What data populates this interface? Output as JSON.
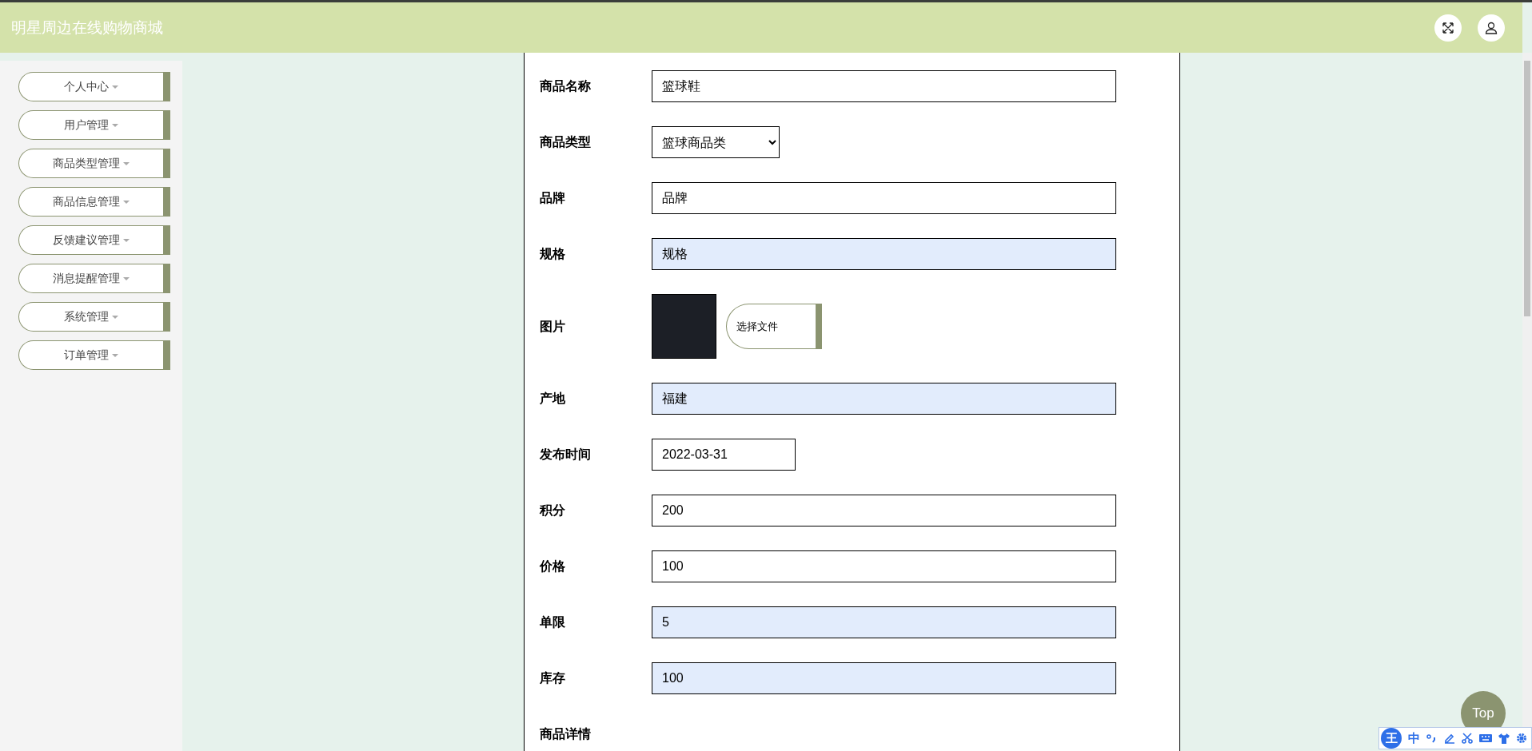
{
  "header": {
    "title": "明星周边在线购物商城"
  },
  "sidebar": {
    "items": [
      {
        "label": "个人中心"
      },
      {
        "label": "用户管理"
      },
      {
        "label": "商品类型管理"
      },
      {
        "label": "商品信息管理"
      },
      {
        "label": "反馈建议管理"
      },
      {
        "label": "消息提醒管理"
      },
      {
        "label": "系统管理"
      },
      {
        "label": "订单管理"
      }
    ]
  },
  "form": {
    "fields": [
      {
        "kind": "text",
        "label": "商品名称",
        "value": "篮球鞋",
        "autofilled": false
      },
      {
        "kind": "select",
        "label": "商品类型",
        "value": "篮球商品类"
      },
      {
        "kind": "text",
        "label": "品牌",
        "value": "品牌",
        "autofilled": false
      },
      {
        "kind": "text",
        "label": "规格",
        "value": "规格",
        "autofilled": true
      },
      {
        "kind": "image",
        "label": "图片",
        "button": "选择文件"
      },
      {
        "kind": "text",
        "label": "产地",
        "value": "福建",
        "autofilled": true
      },
      {
        "kind": "date",
        "label": "发布时间",
        "value": "2022-03-31",
        "autofilled": false
      },
      {
        "kind": "text",
        "label": "积分",
        "value": "200",
        "autofilled": false
      },
      {
        "kind": "text",
        "label": "价格",
        "value": "100",
        "autofilled": false
      },
      {
        "kind": "text",
        "label": "单限",
        "value": "5",
        "autofilled": true
      },
      {
        "kind": "text",
        "label": "库存",
        "value": "100",
        "autofilled": true
      },
      {
        "kind": "heading",
        "label": "商品详情"
      }
    ]
  },
  "top_button": "Top",
  "ime_toolbar": {
    "logo": "王",
    "mode": "中"
  }
}
